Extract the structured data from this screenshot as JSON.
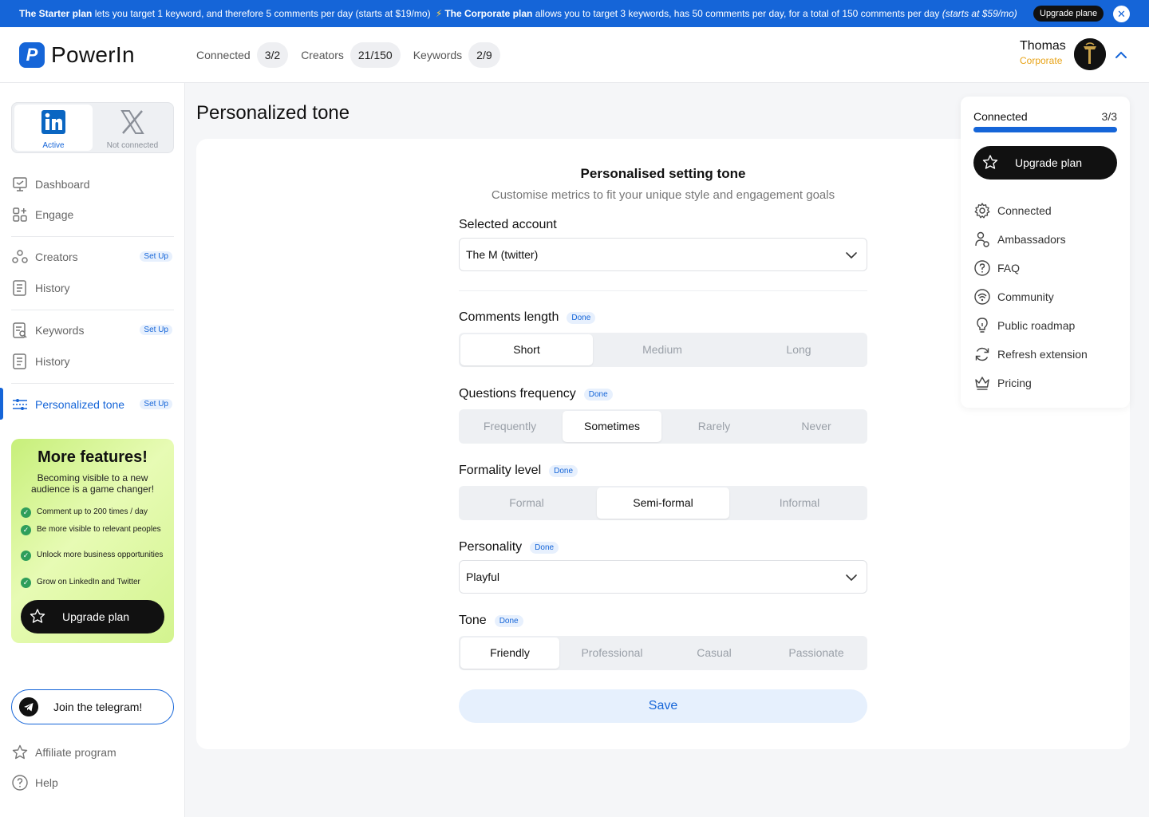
{
  "promo": {
    "starter_name": "The Starter plan",
    "starter_text": " lets you target 1 keyword, and therefore 5 comments per day (starts at $19/mo) ",
    "corporate_name": "The Corporate plan",
    "corporate_text": " allows you to target 3 keywords, has 50 comments per day, for a total of 150 comments per day ",
    "corporate_price": "(starts at $59/mo)",
    "upgrade_label": "Upgrade plane",
    "close_glyph": "✕"
  },
  "brand": {
    "logo_letter": "P",
    "name": "PowerIn"
  },
  "header_stats": [
    {
      "label": "Connected",
      "value": "3/2"
    },
    {
      "label": "Creators",
      "value": "21/150"
    },
    {
      "label": "Keywords",
      "value": "2/9"
    }
  ],
  "user": {
    "name": "Thomas",
    "plan": "Corporate"
  },
  "networks": {
    "linkedin": {
      "status": "Active"
    },
    "x": {
      "status": "Not connected"
    }
  },
  "sidebar": {
    "dashboard": "Dashboard",
    "engage": "Engage",
    "creators": "Creators",
    "creators_badge": "Set Up",
    "history1": "History",
    "keywords": "Keywords",
    "keywords_badge": "Set Up",
    "history2": "History",
    "personalized_tone": "Personalized tone",
    "personalized_badge": "Set Up",
    "telegram": "Join the telegram!",
    "affiliate": "Affiliate program",
    "help": "Help"
  },
  "features_card": {
    "title": "More features!",
    "subtitle": "Becoming visible to a new audience is a game changer!",
    "items": [
      "Comment up to 200 times / day",
      "Be more visible to relevant peoples",
      "Unlock more business opportunities",
      "Grow on LinkedIn and Twitter"
    ],
    "upgrade_label": "Upgrade plan"
  },
  "main": {
    "page_title": "Personalized tone",
    "card_title": "Personalised setting tone",
    "card_subtitle": "Customise metrics to fit your unique style and engagement goals",
    "selected_account_label": "Selected account",
    "selected_account_value": "The M (twitter)",
    "done_label": "Done",
    "comments_length": {
      "label": "Comments length",
      "options": [
        "Short",
        "Medium",
        "Long"
      ],
      "selected": "Short"
    },
    "questions_frequency": {
      "label": "Questions frequency",
      "options": [
        "Frequently",
        "Sometimes",
        "Rarely",
        "Never"
      ],
      "selected": "Sometimes"
    },
    "formality_level": {
      "label": "Formality level",
      "options": [
        "Formal",
        "Semi-formal",
        "Informal"
      ],
      "selected": "Semi-formal"
    },
    "personality": {
      "label": "Personality",
      "value": "Playful"
    },
    "tone": {
      "label": "Tone",
      "options": [
        "Friendly",
        "Professional",
        "Casual",
        "Passionate"
      ],
      "selected": "Friendly"
    },
    "save_label": "Save"
  },
  "panel": {
    "connected_label": "Connected",
    "connected_count": "3/3",
    "connected_fraction": 1.0,
    "upgrade_label": "Upgrade plan",
    "items": [
      "Connected",
      "Ambassadors",
      "FAQ",
      "Community",
      "Public roadmap",
      "Refresh extension",
      "Pricing"
    ]
  },
  "colors": {
    "accent": "#1565d8",
    "plan": "#e8a317",
    "promo_green": "#c7ef7a",
    "dark": "#111111"
  }
}
